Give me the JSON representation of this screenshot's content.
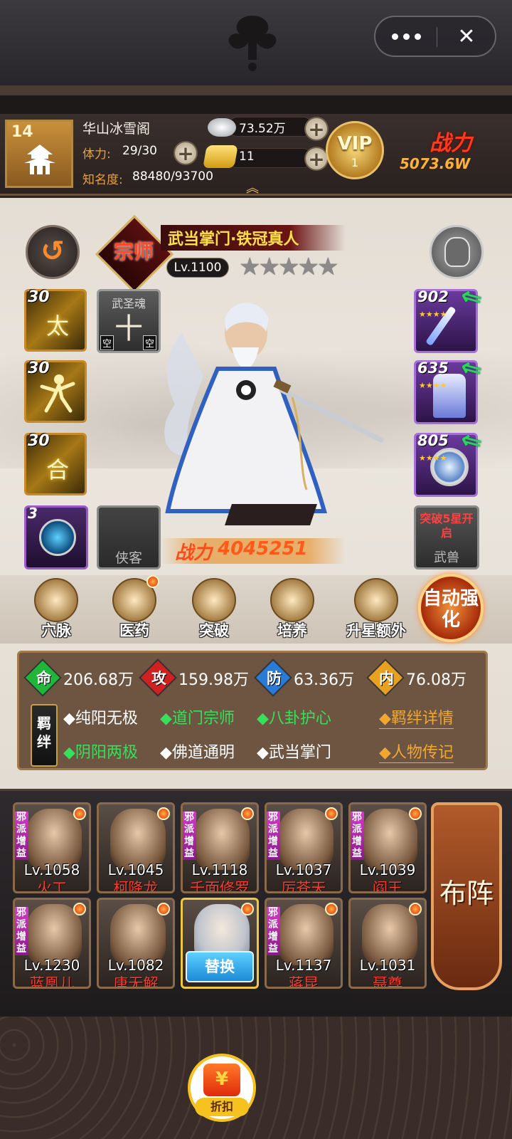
{
  "topbar": {
    "more_icon": "ellipsis-icon",
    "close_icon": "close-icon",
    "close_glyph": "✕"
  },
  "player": {
    "level": "14",
    "sect_name": "华山冰雪阁",
    "stamina_label": "体力:",
    "stamina_value": "29/30",
    "fame_label": "知名度:",
    "fame_value": "88480/93700",
    "silver": "73.52万",
    "gold": "11",
    "vip_label": "VIP",
    "vip_level": "1",
    "power_label": "战力",
    "power_value": "5073.6W"
  },
  "hero": {
    "rank_glyph": "宗师",
    "title": "武当掌门·铁冠真人",
    "level": "Lv.1100",
    "stars": 5,
    "power_label": "战力",
    "power_value": "4045251"
  },
  "skills": [
    {
      "level": "30",
      "glyph": "太"
    },
    {
      "level": "30",
      "glyph": ""
    },
    {
      "level": "30",
      "glyph": "合"
    }
  ],
  "soul_slot": {
    "label": "武圣魂",
    "glyph": "十",
    "empty1": "空",
    "empty2": "空"
  },
  "orb_slot": {
    "level": "3"
  },
  "xiake_slot": {
    "label": "侠客"
  },
  "equipment": [
    {
      "level": "902"
    },
    {
      "level": "635"
    },
    {
      "level": "805"
    }
  ],
  "beast_slot": {
    "note": "突破5星开启",
    "label": "武兽"
  },
  "functions": [
    {
      "label": "穴脉"
    },
    {
      "label": "医药"
    },
    {
      "label": "突破"
    },
    {
      "label": "培养"
    },
    {
      "label": "升星额外"
    }
  ],
  "auto_button": {
    "label": "自动强化"
  },
  "stats": [
    {
      "char": "命",
      "value": "206.68万",
      "color": "#1fb63a"
    },
    {
      "char": "攻",
      "value": "159.98万",
      "color": "#d02020"
    },
    {
      "char": "防",
      "value": "63.36万",
      "color": "#2a7ad8"
    },
    {
      "char": "内",
      "value": "76.08万",
      "color": "#e8a020"
    }
  ],
  "bonds": {
    "tag": "羁绊",
    "items": [
      {
        "text": "◆纯阳无极",
        "active": false
      },
      {
        "text": "◆道门宗师",
        "active": true
      },
      {
        "text": "◆八卦护心",
        "active": true
      },
      {
        "text": "◆阴阳两极",
        "active": true
      },
      {
        "text": "◆佛道通明",
        "active": false
      },
      {
        "text": "◆武当掌门",
        "active": false
      }
    ],
    "detail_link": "◆羁绊详情",
    "bio_link": "◆人物传记"
  },
  "team": [
    {
      "level": "Lv.1058",
      "name": "火工",
      "evil": "邪派增益"
    },
    {
      "level": "Lv.1045",
      "name": "柯降龙",
      "evil": ""
    },
    {
      "level": "Lv.1118",
      "name": "千面修罗",
      "evil": "邪派增益"
    },
    {
      "level": "Lv.1037",
      "name": "厉苍天",
      "evil": "邪派增益"
    },
    {
      "level": "Lv.1039",
      "name": "阎王",
      "evil": "邪派增益"
    },
    {
      "level": "Lv.1230",
      "name": "蓝凰儿",
      "evil": "邪派增益"
    },
    {
      "level": "Lv.1082",
      "name": "唐无解",
      "evil": ""
    },
    {
      "level": "",
      "name": "",
      "evil": "",
      "swap": "替换"
    },
    {
      "level": "Lv.1137",
      "name": "蒋昆",
      "evil": "邪派增益"
    },
    {
      "level": "Lv.1031",
      "name": "聂尊",
      "evil": ""
    }
  ],
  "formation_button": {
    "label": "布阵"
  },
  "discount_button": {
    "glyph": "¥",
    "label": "折扣"
  }
}
